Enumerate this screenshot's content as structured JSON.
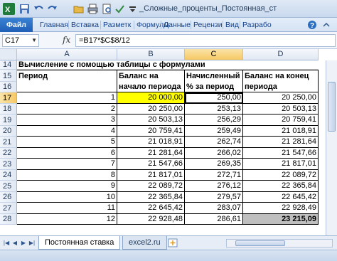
{
  "window": {
    "title": "_Сложные_проценты_Постоянная_ст",
    "quick_access": [
      "excel-icon",
      "save-icon",
      "undo-icon",
      "redo-icon",
      "folder-icon",
      "print-icon",
      "preview-icon",
      "check-icon",
      "customize-icon"
    ]
  },
  "ribbon": {
    "tabs": [
      "Файл",
      "Главная",
      "Вставка",
      "Разметк",
      "Формулы",
      "Данные",
      "Рецензи",
      "Вид",
      "Разрабо"
    ]
  },
  "formula_bar": {
    "name_box": "C17",
    "fx": "fx",
    "formula": "=B17*$C$8/12"
  },
  "columns": [
    "A",
    "B",
    "C",
    "D"
  ],
  "rows": {
    "header_row_numbers": [
      "14",
      "15",
      "16"
    ],
    "title": "Вычисление с помощью таблицы с формулами",
    "headers": {
      "a": "Период",
      "b": "Баланс на начало периода",
      "c": "Начисленный % за период",
      "d": "Баланс на конец периода"
    },
    "data": [
      {
        "row": "17",
        "period": "1",
        "start": "20 000,00",
        "interest": "250,00",
        "end": "20 250,00"
      },
      {
        "row": "18",
        "period": "2",
        "start": "20 250,00",
        "interest": "253,13",
        "end": "20 503,13"
      },
      {
        "row": "19",
        "period": "3",
        "start": "20 503,13",
        "interest": "256,29",
        "end": "20 759,41"
      },
      {
        "row": "20",
        "period": "4",
        "start": "20 759,41",
        "interest": "259,49",
        "end": "21 018,91"
      },
      {
        "row": "21",
        "period": "5",
        "start": "21 018,91",
        "interest": "262,74",
        "end": "21 281,64"
      },
      {
        "row": "22",
        "period": "6",
        "start": "21 281,64",
        "interest": "266,02",
        "end": "21 547,66"
      },
      {
        "row": "23",
        "period": "7",
        "start": "21 547,66",
        "interest": "269,35",
        "end": "21 817,01"
      },
      {
        "row": "24",
        "period": "8",
        "start": "21 817,01",
        "interest": "272,71",
        "end": "22 089,72"
      },
      {
        "row": "25",
        "period": "9",
        "start": "22 089,72",
        "interest": "276,12",
        "end": "22 365,84"
      },
      {
        "row": "26",
        "period": "10",
        "start": "22 365,84",
        "interest": "279,57",
        "end": "22 645,42"
      },
      {
        "row": "27",
        "period": "11",
        "start": "22 645,42",
        "interest": "283,07",
        "end": "22 928,49"
      },
      {
        "row": "28",
        "period": "12",
        "start": "22 928,48",
        "interest": "286,61",
        "end": "23 215,09"
      }
    ]
  },
  "sheets": [
    "Постоянная ставка",
    "excel2.ru"
  ],
  "colors": {
    "highlight_input": "#ffff00",
    "highlight_result": "#bfbfbf",
    "selected_header": "#f6c864"
  }
}
